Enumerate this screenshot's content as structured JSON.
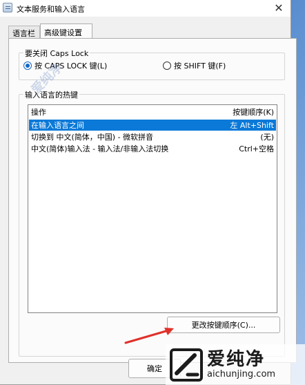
{
  "window": {
    "title": "文本服务和输入语言",
    "close_glyph": "✕"
  },
  "tabs": [
    {
      "label": "语言栏",
      "selected": false
    },
    {
      "label": "高级键设置",
      "selected": true
    }
  ],
  "caps_lock_group": {
    "label": "要关闭 Caps Lock",
    "options": [
      {
        "label": "按 CAPS LOCK 键(L)",
        "selected": true
      },
      {
        "label": "按 SHIFT 键(F)",
        "selected": false
      }
    ]
  },
  "hotkeys_group": {
    "label": "输入语言的热键",
    "columns": {
      "action": "操作",
      "key_sequence": "按键顺序(K)"
    },
    "rows": [
      {
        "action": "在输入语言之间",
        "keys": "左 Alt+Shift",
        "selected": true
      },
      {
        "action": "切换到 中文(简体，中国) - 微软拼音",
        "keys": "(无)",
        "selected": false
      },
      {
        "action": "中文(简体)输入法 - 输入法/非输入法切换",
        "keys": "Ctrl+空格",
        "selected": false
      }
    ],
    "change_button": "更改按键顺序(C)..."
  },
  "footer": {
    "ok_button": "确定"
  },
  "watermark": {
    "name": "爱纯净",
    "url": "aichunjing.com",
    "faint_text": "爱纯净"
  },
  "colors": {
    "selection": "#0b79d8",
    "radio_accent": "#1366c6",
    "arrow": "#e0302a"
  }
}
